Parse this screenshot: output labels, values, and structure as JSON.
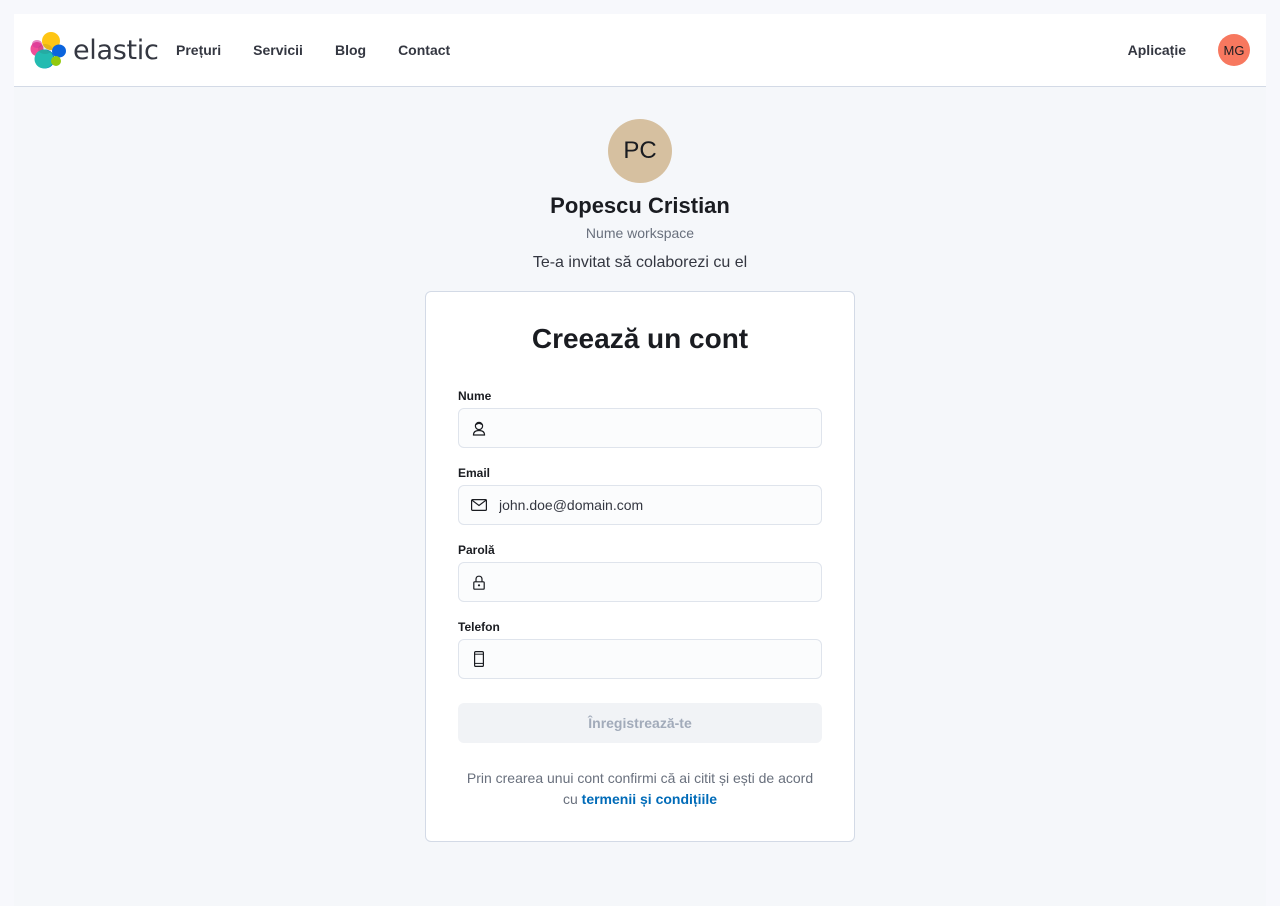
{
  "header": {
    "logo_text": "elastic",
    "nav": [
      "Prețuri",
      "Servicii",
      "Blog",
      "Contact"
    ],
    "app_link": "Aplicație",
    "user_initials": "MG",
    "user_avatar_color": "#f7785f"
  },
  "invite": {
    "initials": "PC",
    "avatar_color": "#d6c0a0",
    "name": "Popescu Cristian",
    "workspace": "Nume workspace",
    "message": "Te-a invitat să colaborezi cu el"
  },
  "form": {
    "title": "Creează un cont",
    "fields": [
      {
        "label": "Nume",
        "icon": "user-icon",
        "value": "",
        "placeholder": ""
      },
      {
        "label": "Email",
        "icon": "email-icon",
        "value": "",
        "placeholder": "john.doe@domain.com"
      },
      {
        "label": "Parolă",
        "icon": "lock-icon",
        "value": "",
        "placeholder": ""
      },
      {
        "label": "Telefon",
        "icon": "phone-icon",
        "value": "",
        "placeholder": ""
      }
    ],
    "submit_label": "Înregistrează-te",
    "terms_text": "Prin crearea unui cont confirmi că ai citit și ești de acord cu",
    "terms_link": "termenii și condițiile",
    "link_color": "#006bb8"
  }
}
